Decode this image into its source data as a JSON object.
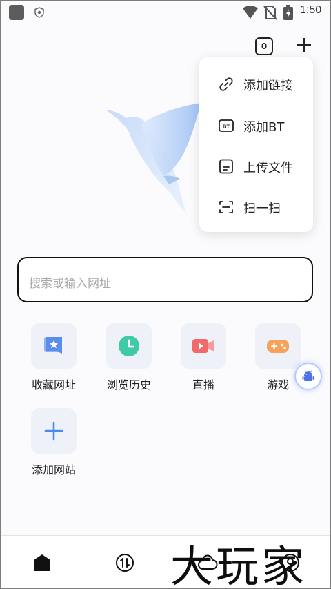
{
  "status_bar": {
    "time": "1:50"
  },
  "toolbar": {
    "tab_count": "0"
  },
  "popup_menu": {
    "items": [
      {
        "label": "添加链接",
        "icon": "link-icon"
      },
      {
        "label": "添加BT",
        "icon": "bt-icon",
        "badge": "BT"
      },
      {
        "label": "上传文件",
        "icon": "file-icon"
      },
      {
        "label": "扫一扫",
        "icon": "scan-icon"
      }
    ]
  },
  "search": {
    "placeholder": "搜索或输入网址"
  },
  "shortcuts": [
    {
      "label": "收藏网址",
      "icon": "bookmark-star-icon",
      "color": "#5b8def"
    },
    {
      "label": "浏览历史",
      "icon": "history-clock-icon",
      "color": "#3ec9a7"
    },
    {
      "label": "直播",
      "icon": "live-video-icon",
      "color": "#f06a6a"
    },
    {
      "label": "游戏",
      "icon": "game-controller-icon",
      "color": "#f6a25b"
    },
    {
      "label": "添加网站",
      "icon": "add-icon",
      "color": "#4a8ae8"
    }
  ],
  "bottom_nav": [
    {
      "icon": "home-icon"
    },
    {
      "icon": "transfer-icon"
    },
    {
      "icon": "cloud-icon"
    },
    {
      "icon": "profile-icon"
    }
  ],
  "watermark": "大玩家"
}
